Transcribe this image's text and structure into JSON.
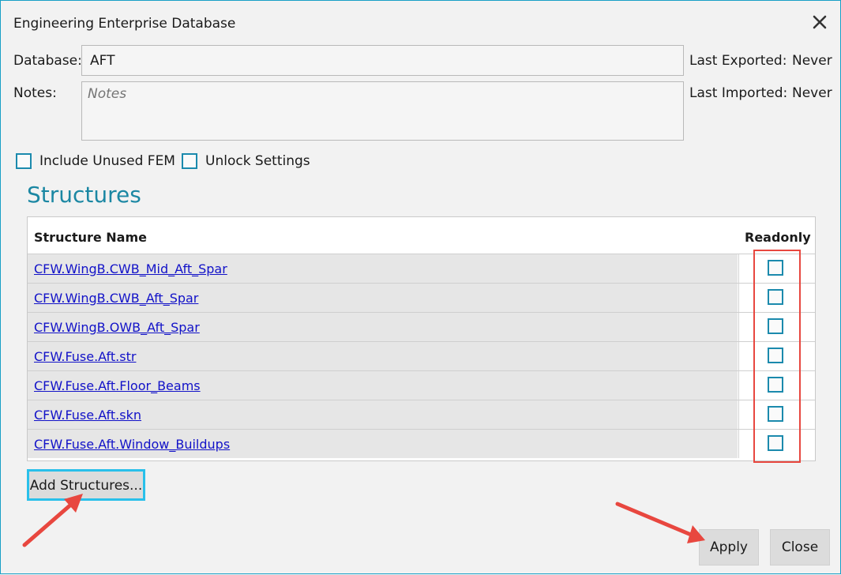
{
  "window": {
    "title": "Engineering Enterprise Database"
  },
  "form": {
    "database_label": "Database:",
    "database_value": "AFT",
    "notes_label": "Notes:",
    "notes_placeholder": "Notes",
    "last_exported_label": "Last Exported:",
    "last_exported_value": "Never",
    "last_imported_label": "Last Imported:",
    "last_imported_value": "Never"
  },
  "options": {
    "include_unused_fem": {
      "label": "Include Unused FEM",
      "checked": false
    },
    "unlock_settings": {
      "label": "Unlock Settings",
      "checked": false
    }
  },
  "structures": {
    "title": "Structures",
    "columns": [
      "Structure Name",
      "Readonly"
    ],
    "rows": [
      {
        "name": "CFW.WingB.CWB_Mid_Aft_Spar",
        "readonly": false
      },
      {
        "name": "CFW.WingB.CWB_Aft_Spar",
        "readonly": false
      },
      {
        "name": "CFW.WingB.OWB_Aft_Spar",
        "readonly": false
      },
      {
        "name": "CFW.Fuse.Aft.str",
        "readonly": false
      },
      {
        "name": "CFW.Fuse.Aft.Floor_Beams",
        "readonly": false
      },
      {
        "name": "CFW.Fuse.Aft.skn",
        "readonly": false
      },
      {
        "name": "CFW.Fuse.Aft.Window_Buildups",
        "readonly": false
      }
    ]
  },
  "buttons": {
    "add_structures": "Add Structures...",
    "apply": "Apply",
    "close": "Close"
  },
  "colors": {
    "accent": "#1b87a3",
    "checkbox_border": "#1b8aad",
    "link": "#1212c8",
    "annotation_red": "#e8473f",
    "focus_blue": "#29c0ea"
  },
  "icons": {
    "close": "close-icon",
    "annotation_arrow": "arrow-icon"
  }
}
